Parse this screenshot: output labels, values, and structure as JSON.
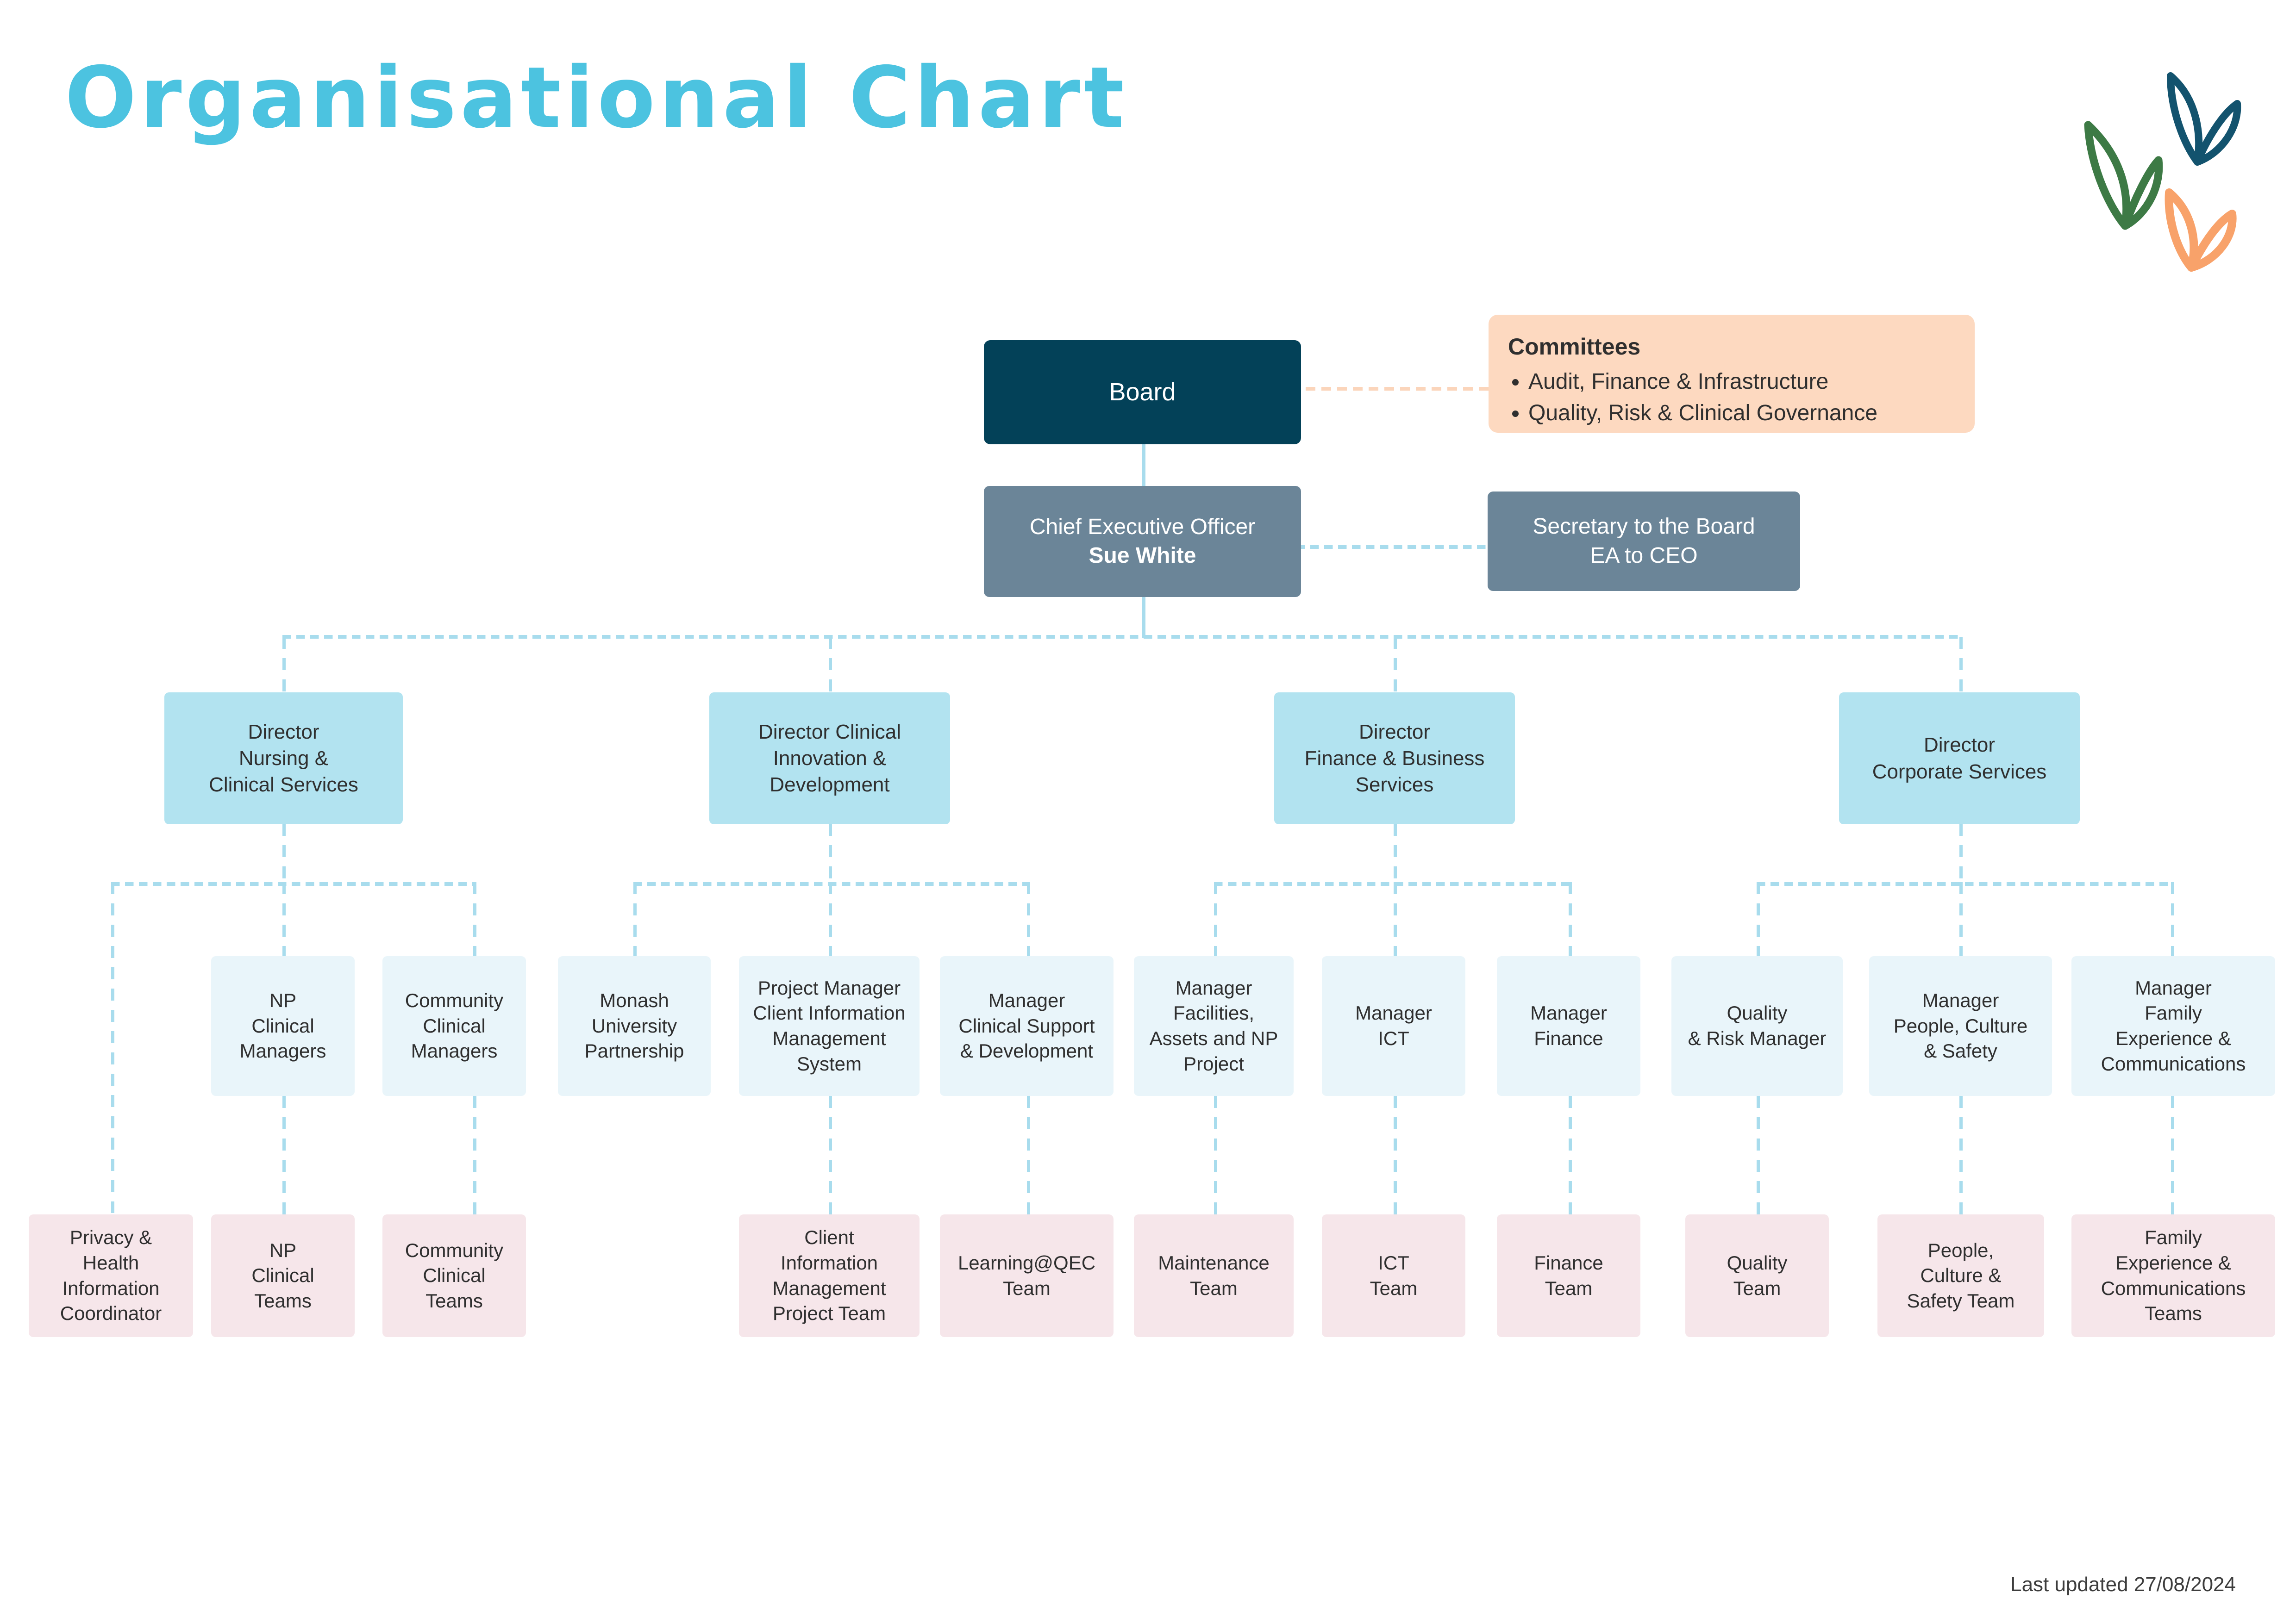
{
  "page": {
    "title": "Organisational Chart",
    "title_color": "#4cc3e0",
    "footer": "Last updated 27/08/2024",
    "background": "#ffffff"
  },
  "colors": {
    "board": "#034158",
    "executive": "#6b8598",
    "committees": "#fdd9c0",
    "director": "#b2e3f0",
    "manager": "#e9f5fa",
    "team": "#f6e6ea",
    "connector": "#a8dced",
    "connector_peach": "#fbd5bb",
    "doodle_green": "#3d7a45",
    "doodle_navy": "#13536e",
    "doodle_orange": "#f8a26a"
  },
  "decorations": [
    {
      "name": "leaf-doodle-green",
      "color": "#3d7a45"
    },
    {
      "name": "leaf-doodle-navy",
      "color": "#13536e"
    },
    {
      "name": "leaf-doodle-orange",
      "color": "#f8a26a"
    }
  ],
  "board": {
    "label": "Board"
  },
  "committees": {
    "heading": "Committees",
    "items": [
      "Audit, Finance & Infrastructure",
      "Quality, Risk & Clinical Governance"
    ]
  },
  "ceo": {
    "role": "Chief Executive Officer",
    "name": "Sue White"
  },
  "secretary": {
    "line1": "Secretary to the Board",
    "line2": "EA to CEO"
  },
  "directors": [
    {
      "lines": [
        "Director",
        "Nursing &",
        "Clinical Services"
      ]
    },
    {
      "lines": [
        "Director Clinical",
        "Innovation &",
        "Development"
      ]
    },
    {
      "lines": [
        "Director",
        "Finance & Business",
        "Services"
      ]
    },
    {
      "lines": [
        "Director",
        "Corporate Services"
      ]
    }
  ],
  "managers": [
    {
      "lines": [
        "NP",
        "Clinical",
        "Managers"
      ]
    },
    {
      "lines": [
        "Community",
        "Clinical",
        "Managers"
      ]
    },
    {
      "lines": [
        "Monash",
        "University",
        "Partnership"
      ]
    },
    {
      "lines": [
        "Project Manager",
        "Client Information",
        "Management",
        "System"
      ]
    },
    {
      "lines": [
        "Manager",
        "Clinical Support",
        "& Development"
      ]
    },
    {
      "lines": [
        "Manager",
        "Facilities,",
        "Assets and NP",
        "Project"
      ]
    },
    {
      "lines": [
        "Manager",
        "ICT"
      ]
    },
    {
      "lines": [
        "Manager",
        "Finance"
      ]
    },
    {
      "lines": [
        "Quality",
        "& Risk Manager"
      ]
    },
    {
      "lines": [
        "Manager",
        "People, Culture",
        "& Safety"
      ]
    },
    {
      "lines": [
        "Manager",
        "Family",
        "Experience &",
        "Communications"
      ]
    }
  ],
  "teams": [
    {
      "lines": [
        "Privacy &",
        "Health",
        "Information",
        "Coordinator"
      ]
    },
    {
      "lines": [
        "NP",
        "Clinical",
        "Teams"
      ]
    },
    {
      "lines": [
        "Community",
        "Clinical",
        "Teams"
      ]
    },
    {
      "lines": [
        "Client",
        "Information",
        "Management",
        "Project Team"
      ]
    },
    {
      "lines": [
        "Learning@QEC",
        "Team"
      ]
    },
    {
      "lines": [
        "Maintenance",
        "Team"
      ]
    },
    {
      "lines": [
        "ICT",
        "Team"
      ]
    },
    {
      "lines": [
        "Finance",
        "Team"
      ]
    },
    {
      "lines": [
        "Quality",
        "Team"
      ]
    },
    {
      "lines": [
        "People,",
        "Culture &",
        "Safety Team"
      ]
    },
    {
      "lines": [
        "Family",
        "Experience &",
        "Communications",
        "Teams"
      ]
    }
  ]
}
